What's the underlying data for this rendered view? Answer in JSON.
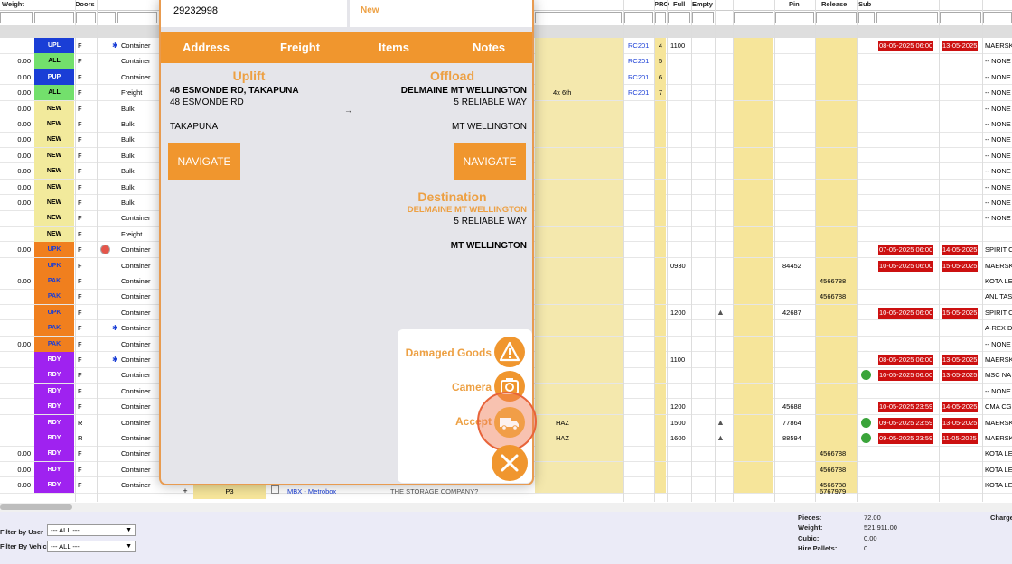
{
  "grid": {
    "headers": [
      "Weight",
      "Doors",
      "PRO",
      "Full",
      "Empty",
      "Pin",
      "Release",
      "Sub"
    ],
    "rows": [
      {
        "weight": "",
        "status": "UPL",
        "door": "F",
        "type": "Container",
        "rc": "RC201",
        "pro": "4",
        "full": "1100",
        "pin": "",
        "release": "",
        "d1": "08-05-2025 06:00",
        "d2": "13-05-2025",
        "cust": "MAERSK",
        "sc": "#1a3ed6",
        "tc": "#ffffff",
        "excl": false,
        "star": true,
        "tri": false,
        "check": false,
        "haz": "",
        "rowc": ""
      },
      {
        "weight": "0.00",
        "status": "ALL",
        "door": "F",
        "type": "Container",
        "rc": "RC201",
        "pro": "5",
        "full": "",
        "pin": "",
        "release": "",
        "d1": "",
        "d2": "",
        "cust": "-- NONE",
        "sc": "#73e06c",
        "tc": "#000",
        "excl": false,
        "star": false,
        "tri": false,
        "check": false,
        "haz": "",
        "rowc": ""
      },
      {
        "weight": "0.00",
        "status": "PUP",
        "door": "F",
        "type": "Container",
        "rc": "RC201",
        "pro": "6",
        "full": "",
        "pin": "",
        "release": "",
        "d1": "",
        "d2": "",
        "cust": "-- NONE",
        "sc": "#1a3ed6",
        "tc": "#ffffff",
        "excl": false,
        "star": false,
        "tri": false,
        "check": false,
        "haz": "",
        "rowc": ""
      },
      {
        "weight": "0.00",
        "status": "ALL",
        "door": "F",
        "type": "Freight",
        "rc": "RC201",
        "pro": "7",
        "full": "",
        "pin": "",
        "release": "",
        "d1": "",
        "d2": "",
        "cust": "-- NONE",
        "sc": "#73e06c",
        "tc": "#000",
        "excl": false,
        "star": false,
        "tri": false,
        "check": false,
        "haz": "",
        "rowc": "4x 6th"
      },
      {
        "weight": "0.00",
        "status": "NEW",
        "door": "F",
        "type": "Bulk",
        "rc": "",
        "pro": "",
        "full": "",
        "pin": "",
        "release": "",
        "d1": "",
        "d2": "",
        "cust": "-- NONE",
        "sc": "#f2ea9c",
        "tc": "#000",
        "excl": false,
        "star": false,
        "tri": false,
        "check": false,
        "haz": "",
        "rowc": ""
      },
      {
        "weight": "0.00",
        "status": "NEW",
        "door": "F",
        "type": "Bulk",
        "rc": "",
        "pro": "",
        "full": "",
        "pin": "",
        "release": "",
        "d1": "",
        "d2": "",
        "cust": "-- NONE",
        "sc": "#f2ea9c",
        "tc": "#000",
        "excl": false,
        "star": false,
        "tri": false,
        "check": false,
        "haz": "",
        "rowc": ""
      },
      {
        "weight": "0.00",
        "status": "NEW",
        "door": "F",
        "type": "Bulk",
        "rc": "",
        "pro": "",
        "full": "",
        "pin": "",
        "release": "",
        "d1": "",
        "d2": "",
        "cust": "-- NONE",
        "sc": "#f2ea9c",
        "tc": "#000",
        "excl": false,
        "star": false,
        "tri": false,
        "check": false,
        "haz": "",
        "rowc": ""
      },
      {
        "weight": "0.00",
        "status": "NEW",
        "door": "F",
        "type": "Bulk",
        "rc": "",
        "pro": "",
        "full": "",
        "pin": "",
        "release": "",
        "d1": "",
        "d2": "",
        "cust": "-- NONE",
        "sc": "#f2ea9c",
        "tc": "#000",
        "excl": false,
        "star": false,
        "tri": false,
        "check": false,
        "haz": "",
        "rowc": ""
      },
      {
        "weight": "0.00",
        "status": "NEW",
        "door": "F",
        "type": "Bulk",
        "rc": "",
        "pro": "",
        "full": "",
        "pin": "",
        "release": "",
        "d1": "",
        "d2": "",
        "cust": "-- NONE",
        "sc": "#f2ea9c",
        "tc": "#000",
        "excl": false,
        "star": false,
        "tri": false,
        "check": false,
        "haz": "",
        "rowc": ""
      },
      {
        "weight": "0.00",
        "status": "NEW",
        "door": "F",
        "type": "Bulk",
        "rc": "",
        "pro": "",
        "full": "",
        "pin": "",
        "release": "",
        "d1": "",
        "d2": "",
        "cust": "-- NONE",
        "sc": "#f2ea9c",
        "tc": "#000",
        "excl": false,
        "star": false,
        "tri": false,
        "check": false,
        "haz": "",
        "rowc": ""
      },
      {
        "weight": "0.00",
        "status": "NEW",
        "door": "F",
        "type": "Bulk",
        "rc": "",
        "pro": "",
        "full": "",
        "pin": "",
        "release": "",
        "d1": "",
        "d2": "",
        "cust": "-- NONE",
        "sc": "#f2ea9c",
        "tc": "#000",
        "excl": false,
        "star": false,
        "tri": false,
        "check": false,
        "haz": "",
        "rowc": ""
      },
      {
        "weight": "",
        "status": "NEW",
        "door": "F",
        "type": "Container",
        "rc": "",
        "pro": "",
        "full": "",
        "pin": "",
        "release": "",
        "d1": "",
        "d2": "",
        "cust": "-- NONE",
        "sc": "#f2ea9c",
        "tc": "#000",
        "excl": false,
        "star": false,
        "tri": false,
        "check": false,
        "haz": "",
        "rowc": ""
      },
      {
        "weight": "",
        "status": "NEW",
        "door": "F",
        "type": "Freight",
        "rc": "",
        "pro": "",
        "full": "",
        "pin": "",
        "release": "",
        "d1": "",
        "d2": "",
        "cust": "",
        "sc": "#f2ea9c",
        "tc": "#000",
        "excl": false,
        "star": false,
        "tri": false,
        "check": false,
        "haz": "",
        "rowc": ""
      },
      {
        "weight": "0.00",
        "status": "UPK",
        "door": "F",
        "type": "Container",
        "rc": "",
        "pro": "",
        "full": "",
        "pin": "",
        "release": "",
        "d1": "07-05-2025 06:00",
        "d2": "14-05-2025",
        "cust": "SPIRIT C",
        "sc": "#f07f1e",
        "tc": "#1a3ed6",
        "excl": true,
        "star": false,
        "tri": false,
        "check": false,
        "haz": "",
        "rowc": ""
      },
      {
        "weight": "",
        "status": "UPK",
        "door": "F",
        "type": "Container",
        "rc": "",
        "pro": "",
        "full": "0930",
        "pin": "84452",
        "release": "",
        "d1": "10-05-2025 06:00",
        "d2": "15-05-2025",
        "cust": "MAERSK",
        "sc": "#f07f1e",
        "tc": "#1a3ed6",
        "excl": false,
        "star": false,
        "tri": false,
        "check": false,
        "haz": "",
        "rowc": ""
      },
      {
        "weight": "0.00",
        "status": "PAK",
        "door": "F",
        "type": "Container",
        "rc": "",
        "pro": "",
        "full": "",
        "pin": "",
        "release": "4566788",
        "d1": "",
        "d2": "",
        "cust": "KOTA LE",
        "sc": "#f07f1e",
        "tc": "#1a3ed6",
        "excl": false,
        "star": false,
        "tri": false,
        "check": false,
        "haz": "",
        "rowc": ""
      },
      {
        "weight": "",
        "status": "PAK",
        "door": "F",
        "type": "Container",
        "rc": "",
        "pro": "",
        "full": "",
        "pin": "",
        "release": "4566788",
        "d1": "",
        "d2": "",
        "cust": "ANL TAS",
        "sc": "#f07f1e",
        "tc": "#1a3ed6",
        "excl": false,
        "star": false,
        "tri": false,
        "check": false,
        "haz": "",
        "rowc": ""
      },
      {
        "weight": "",
        "status": "UPK",
        "door": "F",
        "type": "Container",
        "rc": "",
        "pro": "",
        "full": "1200",
        "pin": "42687",
        "release": "",
        "d1": "10-05-2025 06:00",
        "d2": "15-05-2025",
        "cust": "SPIRIT C",
        "sc": "#f07f1e",
        "tc": "#1a3ed6",
        "excl": false,
        "star": false,
        "tri": true,
        "check": false,
        "haz": "",
        "rowc": ""
      },
      {
        "weight": "",
        "status": "PAK",
        "door": "F",
        "type": "Container",
        "rc": "",
        "pro": "",
        "full": "",
        "pin": "",
        "release": "",
        "d1": "",
        "d2": "",
        "cust": "A-REX D",
        "sc": "#f07f1e",
        "tc": "#1a3ed6",
        "excl": false,
        "star": true,
        "tri": false,
        "check": false,
        "haz": "",
        "rowc": ""
      },
      {
        "weight": "0.00",
        "status": "PAK",
        "door": "F",
        "type": "Container",
        "rc": "",
        "pro": "",
        "full": "",
        "pin": "",
        "release": "",
        "d1": "",
        "d2": "",
        "cust": "-- NONE",
        "sc": "#f07f1e",
        "tc": "#1a3ed6",
        "excl": false,
        "star": false,
        "tri": false,
        "check": false,
        "haz": "",
        "rowc": ""
      },
      {
        "weight": "",
        "status": "RDY",
        "door": "F",
        "type": "Container",
        "rc": "",
        "pro": "",
        "full": "1100",
        "pin": "",
        "release": "",
        "d1": "08-05-2025 06:00",
        "d2": "13-05-2025",
        "cust": "MAERSK",
        "sc": "#9f22f0",
        "tc": "#ffffff",
        "excl": false,
        "star": true,
        "tri": false,
        "check": false,
        "haz": "",
        "rowc": ""
      },
      {
        "weight": "",
        "status": "RDY",
        "door": "F",
        "type": "Container",
        "rc": "",
        "pro": "",
        "full": "",
        "pin": "",
        "release": "",
        "d1": "10-05-2025 06:00",
        "d2": "13-05-2025",
        "cust": "MSC NA",
        "sc": "#9f22f0",
        "tc": "#ffffff",
        "excl": false,
        "star": false,
        "tri": false,
        "check": true,
        "haz": "",
        "rowc": ""
      },
      {
        "weight": "",
        "status": "RDY",
        "door": "F",
        "type": "Container",
        "rc": "",
        "pro": "",
        "full": "",
        "pin": "",
        "release": "",
        "d1": "",
        "d2": "",
        "cust": "-- NONE",
        "sc": "#9f22f0",
        "tc": "#ffffff",
        "excl": false,
        "star": false,
        "tri": false,
        "check": false,
        "haz": "",
        "rowc": ""
      },
      {
        "weight": "",
        "status": "RDY",
        "door": "F",
        "type": "Container",
        "rc": "",
        "pro": "",
        "full": "1200",
        "pin": "45688",
        "release": "",
        "d1": "10-05-2025 23:59",
        "d2": "14-05-2025",
        "cust": "CMA CG",
        "sc": "#9f22f0",
        "tc": "#ffffff",
        "excl": false,
        "star": false,
        "tri": false,
        "check": false,
        "haz": "",
        "rowc": ""
      },
      {
        "weight": "",
        "status": "RDY",
        "door": "R",
        "type": "Container",
        "rc": "",
        "pro": "",
        "full": "1500",
        "pin": "77864",
        "release": "",
        "d1": "09-05-2025 23:59",
        "d2": "13-05-2025",
        "cust": "MAERSK",
        "sc": "#9f22f0",
        "tc": "#ffffff",
        "excl": false,
        "star": false,
        "tri": true,
        "check": true,
        "haz": "HAZ",
        "rowc": ""
      },
      {
        "weight": "",
        "status": "RDY",
        "door": "R",
        "type": "Container",
        "rc": "",
        "pro": "",
        "full": "1600",
        "pin": "88594",
        "release": "",
        "d1": "09-05-2025 23:59",
        "d2": "11-05-2025",
        "cust": "MAERSK",
        "sc": "#9f22f0",
        "tc": "#ffffff",
        "excl": false,
        "star": false,
        "tri": true,
        "check": true,
        "haz": "HAZ",
        "rowc": ""
      },
      {
        "weight": "0.00",
        "status": "RDY",
        "door": "F",
        "type": "Container",
        "rc": "",
        "pro": "",
        "full": "",
        "pin": "",
        "release": "4566788",
        "d1": "",
        "d2": "",
        "cust": "KOTA LE",
        "sc": "#9f22f0",
        "tc": "#ffffff",
        "excl": false,
        "star": false,
        "tri": false,
        "check": false,
        "haz": "",
        "rowc": ""
      },
      {
        "weight": "0.00",
        "status": "RDY",
        "door": "F",
        "type": "Container",
        "rc": "",
        "pro": "",
        "full": "",
        "pin": "",
        "release": "4566788",
        "d1": "",
        "d2": "",
        "cust": "KOTA LE",
        "sc": "#9f22f0",
        "tc": "#ffffff",
        "excl": false,
        "star": false,
        "tri": false,
        "check": false,
        "haz": "",
        "rowc": ""
      },
      {
        "weight": "0.00",
        "status": "RDY",
        "door": "F",
        "type": "Container",
        "rc": "",
        "pro": "",
        "full": "",
        "pin": "",
        "release": "4566788",
        "d1": "",
        "d2": "",
        "cust": "KOTA LE",
        "sc": "#9f22f0",
        "tc": "#ffffff",
        "excl": false,
        "star": false,
        "tri": false,
        "check": false,
        "haz": "",
        "rowc": ""
      }
    ],
    "visible_row": {
      "vehicle": "MBX - Metrobox",
      "client": "THE STORAGE COMPANY?",
      "expand": "+",
      "partial_release": "6767979",
      "partial_code": "P3"
    }
  },
  "footer": {
    "filter_user_label": "Filter by User",
    "filter_vehicle_label": "Filter By Vehicle",
    "filter_user_value": "--- ALL ---",
    "filter_vehicle_value": "--- ALL ---",
    "totals": [
      {
        "label": "Pieces:",
        "value": "72.00"
      },
      {
        "label": "Weight:",
        "value": "521,911.00"
      },
      {
        "label": "Cubic:",
        "value": "0.00"
      },
      {
        "label": "Hire Pallets:",
        "value": "0"
      }
    ],
    "charges_label": "Charge"
  },
  "modal": {
    "job_number": "29232998",
    "status": "New",
    "tabs": [
      "Address",
      "Freight",
      "Items",
      "Notes"
    ],
    "uplift": {
      "heading": "Uplift",
      "name": "48 ESMONDE RD, TAKAPUNA",
      "street": "48 ESMONDE RD",
      "suburb": "TAKAPUNA",
      "navigate": "NAVIGATE"
    },
    "arrow": "→",
    "offload": {
      "heading": "Offload",
      "name": "DELMAINE MT WELLINGTON",
      "street": "5 RELIABLE WAY",
      "suburb": "MT WELLINGTON",
      "navigate": "NAVIGATE"
    },
    "destination": {
      "heading": "Destination",
      "name": "DELMAINE MT WELLINGTON",
      "street": "5 RELIABLE WAY",
      "suburb": "MT WELLINGTON"
    },
    "actions": {
      "damaged": "Damaged Goods",
      "camera": "Camera",
      "accept": "Accept"
    }
  },
  "colors": {
    "accent": "#f0962e",
    "accent_text": "#eda043",
    "date_red": "#cc1010",
    "footer_bg": "#ebebf7"
  }
}
